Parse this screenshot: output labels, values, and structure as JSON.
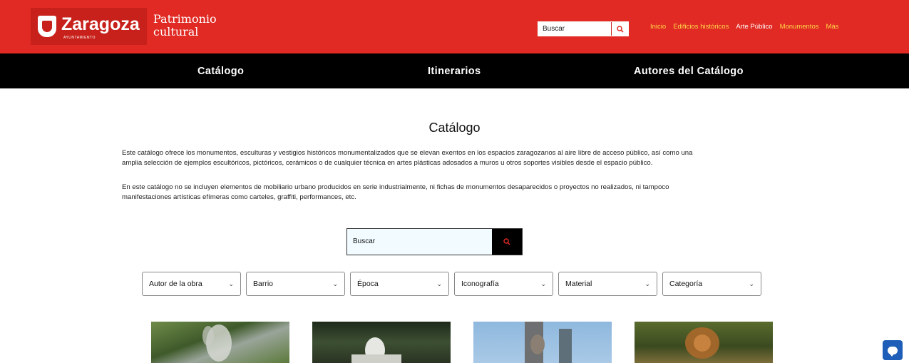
{
  "header": {
    "logo_text": "Zaragoza",
    "logo_sub": "AYUNTAMIENTO",
    "site_title_line1": "Patrimonio",
    "site_title_line2": "cultural",
    "search_placeholder": "Buscar",
    "search_icon": "search-icon",
    "nav": [
      "Inicio",
      "Edificios históricos",
      "Arte Público",
      "Monumentos",
      "Más"
    ],
    "active_nav": "Arte Público"
  },
  "subnav": [
    "Catálogo",
    "Itinerarios",
    "Autores del Catálogo"
  ],
  "main": {
    "title": "Catálogo",
    "paragraph1_line1": "Este catálogo ofrece los monumentos, esculturas y vestigios históricos monumentalizados que se elevan exentos en los espacios zaragozanos al aire libre de acceso público, así como una",
    "paragraph1_line2": "amplia selección de ejemplos escultóricos, pictóricos, cerámicos o de cualquier técnica en artes plásticas adosados a muros u otros soportes visibles desde el espacio público.",
    "paragraph2_line1": "En este catálogo no se incluyen elementos de mobiliario urbano producidos en serie industrialmente, ni fichas de monumentos desaparecidos o proyectos no realizados, ni tampoco",
    "paragraph2_line2": "manifestaciones artísticas efímeras como carteles, graffiti, performances, etc.",
    "search_placeholder": "Buscar",
    "filters": [
      "Autor de la obra",
      "Barrio",
      "Época",
      "Iconografía",
      "Material",
      "Categoría"
    ]
  },
  "colors": {
    "brand_red": "#e02a23",
    "nav_yellow": "#ffd84a",
    "black": "#000000",
    "chat_blue": "#1e5eb8"
  },
  "chat_icon": "chat-icon"
}
